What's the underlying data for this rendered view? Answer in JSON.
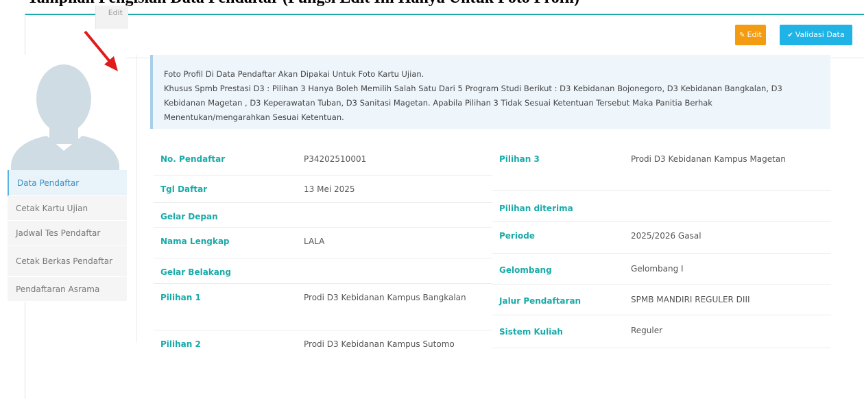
{
  "banner": {
    "title": "Tampilan Pengisian Data Pendaftar (Fungsi Edit Ini Hanya Untuk Foto Profil)"
  },
  "actions": {
    "edit_label": "Edit",
    "validasi_label": "Validasi Data"
  },
  "avatar": {
    "edit_label": "Edit"
  },
  "sidebar": {
    "items": [
      {
        "label": "Data Pendaftar"
      },
      {
        "label": "Cetak Kartu Ujian"
      },
      {
        "label": "Jadwal Tes Pendaftar"
      },
      {
        "label": "Cetak Berkas Pendaftar"
      },
      {
        "label": "Pendaftaran Asrama"
      }
    ]
  },
  "notice": {
    "line1": "Foto Profil Di Data Pendaftar Akan Dipakai Untuk Foto Kartu Ujian.",
    "line2": "Khusus Spmb Prestasi D3 : Pilihan 3 Hanya Boleh Memilih Salah Satu Dari 5 Program Studi Berikut : D3 Kebidanan Bojonegoro, D3 Kebidanan Bangkalan, D3 Kebidanan Magetan , D3 Keperawatan Tuban, D3 Sanitasi Magetan. Apabila Pilihan 3 Tidak Sesuai Ketentuan Tersebut Maka Panitia Berhak Menentukan/mengarahkan Sesuai Ketentuan."
  },
  "left_fields": [
    {
      "label": "No. Pendaftar",
      "value": "P34202510001"
    },
    {
      "label": "Tgl Daftar",
      "value": "13 Mei 2025"
    },
    {
      "label": "Gelar Depan",
      "value": ""
    },
    {
      "label": "Nama Lengkap",
      "value": "LALA"
    },
    {
      "label": "Gelar Belakang",
      "value": ""
    },
    {
      "label": "Pilihan 1",
      "value": "Prodi D3 Kebidanan Kampus Bangkalan"
    },
    {
      "label": "Pilihan 2",
      "value": "Prodi D3 Kebidanan Kampus Sutomo"
    }
  ],
  "right_fields": [
    {
      "label": "Pilihan 3",
      "value": "Prodi D3 Kebidanan Kampus Magetan"
    },
    {
      "label": "Pilihan diterima",
      "value": ""
    },
    {
      "label": "Periode",
      "value": "2025/2026 Gasal"
    },
    {
      "label": "Gelombang",
      "value": "Gelombang I"
    },
    {
      "label": "Jalur Pendaftaran",
      "value": "SPMB MANDIRI REGULER DIII"
    },
    {
      "label": "Sistem Kuliah",
      "value": "Reguler"
    }
  ],
  "icons": {
    "edit": "pencil-icon",
    "validasi": "check-icon",
    "annotation": "red-arrow-icon"
  },
  "colors": {
    "accent": "#1aaaa9",
    "edit_btn": "#f39c12",
    "validasi_btn": "#1fb3e6",
    "arrow": "#e01b1b"
  }
}
